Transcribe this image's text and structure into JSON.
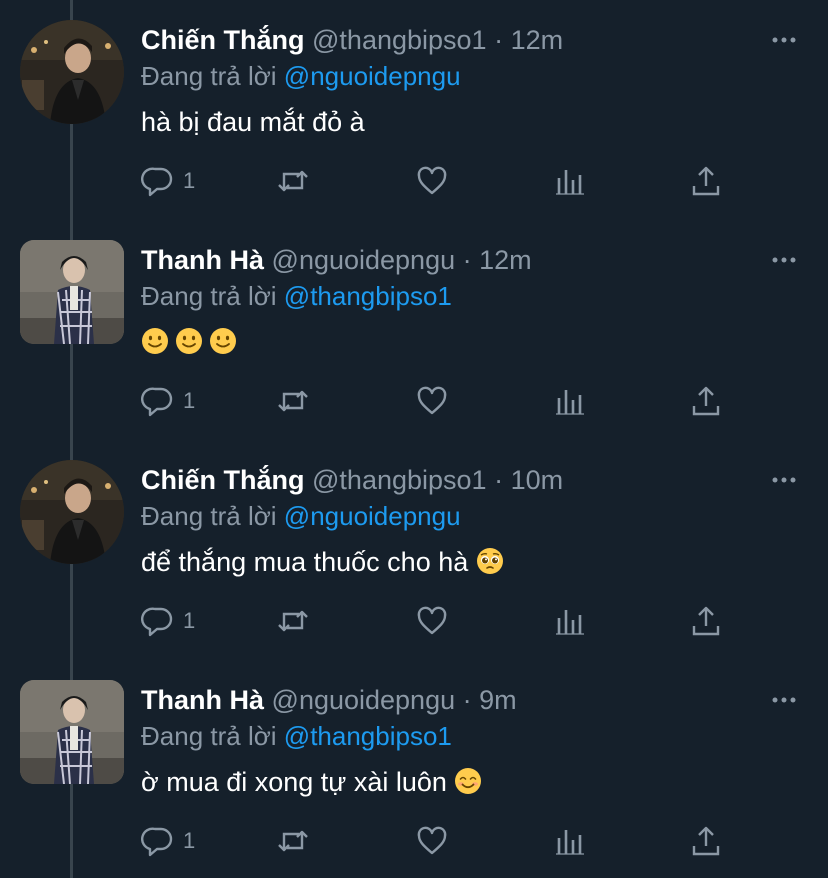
{
  "tweets": [
    {
      "name": "Chiến Thắng",
      "handle": "@thangbipso1",
      "separator": "·",
      "time": "12m",
      "reply_prefix": "Đang trả lời",
      "reply_to": "@nguoidepngu",
      "text": "hà bị đau mắt đỏ à",
      "emojis": [],
      "reply_count": "1",
      "avatar": "round"
    },
    {
      "name": "Thanh Hà",
      "handle": "@nguoidepngu",
      "separator": "·",
      "time": "12m",
      "reply_prefix": "Đang trả lời",
      "reply_to": "@thangbipso1",
      "text": "",
      "emojis": [
        "slightly-smiling-face",
        "slightly-smiling-face",
        "slightly-smiling-face"
      ],
      "reply_count": "1",
      "avatar": "square"
    },
    {
      "name": "Chiến Thắng",
      "handle": "@thangbipso1",
      "separator": "·",
      "time": "10m",
      "reply_prefix": "Đang trả lời",
      "reply_to": "@nguoidepngu",
      "text": "để thắng mua thuốc cho hà",
      "emojis": [
        "pleading-face"
      ],
      "reply_count": "1",
      "avatar": "round"
    },
    {
      "name": "Thanh Hà",
      "handle": "@nguoidepngu",
      "separator": "·",
      "time": "9m",
      "reply_prefix": "Đang trả lời",
      "reply_to": "@thangbipso1",
      "text": "ờ mua đi xong tự xài luôn",
      "emojis": [
        "smiling-face-with-smiling-eyes"
      ],
      "reply_count": "1",
      "avatar": "square"
    }
  ],
  "icons": {
    "more": "more-icon",
    "reply": "reply-icon",
    "retweet": "retweet-icon",
    "like": "heart-icon",
    "stats": "analytics-icon",
    "share": "share-icon"
  },
  "colors": {
    "background": "#15202b",
    "thread_line": "#38444d",
    "name": "#ffffff",
    "secondary": "#8b98a5",
    "mention": "#1d9bf0"
  }
}
